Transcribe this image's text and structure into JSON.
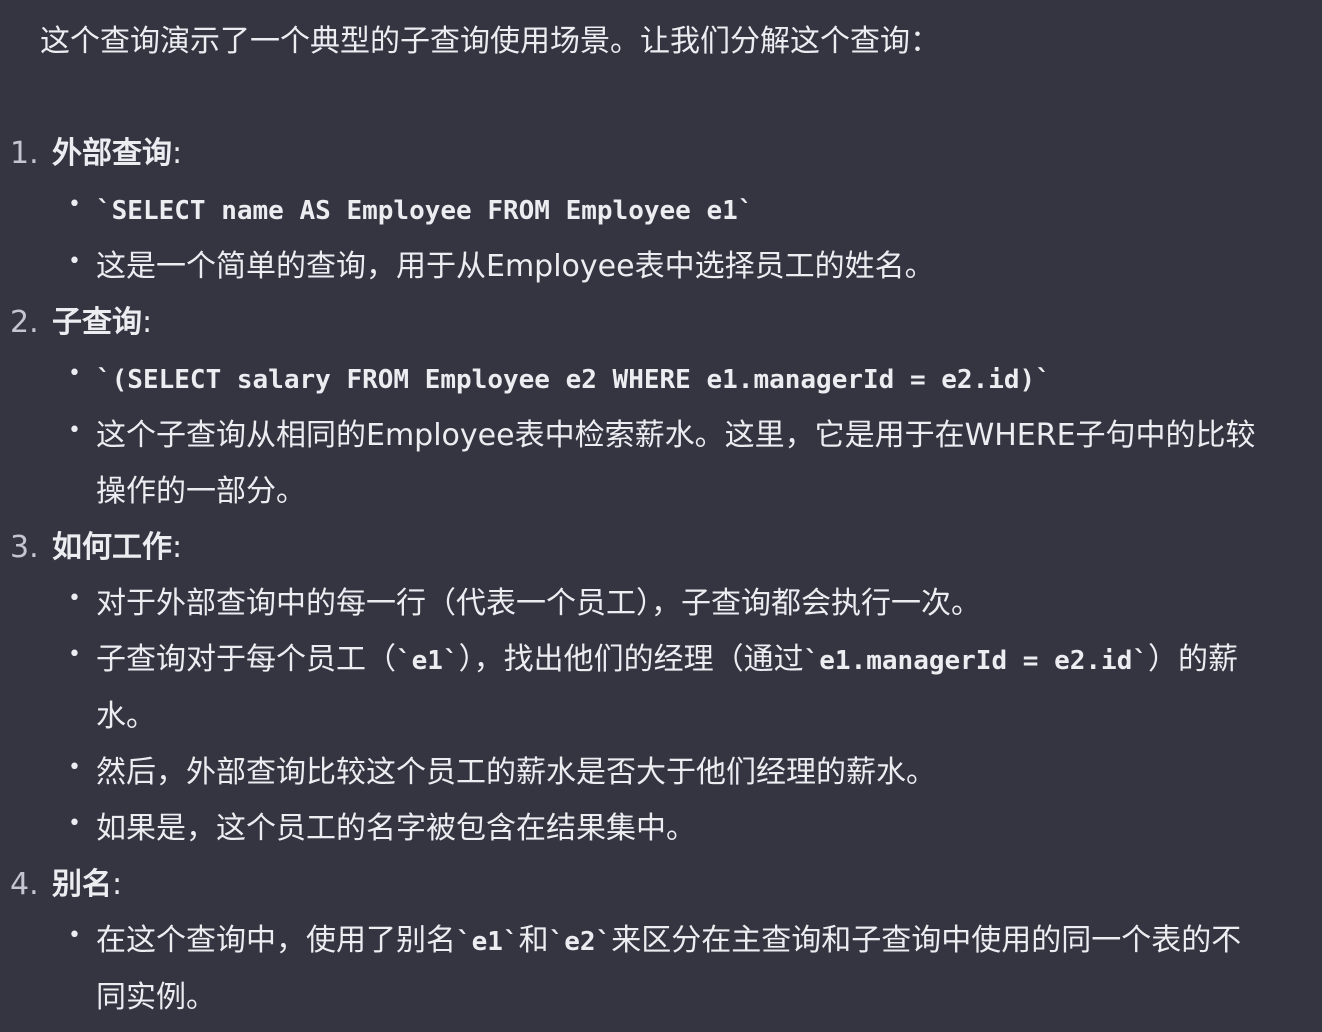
{
  "intro": "这个查询演示了一个典型的子查询使用场景。让我们分解这个查询：",
  "sections": [
    {
      "num": "1.",
      "title": "外部查询",
      "colon": ":",
      "items": [
        {
          "code": "`SELECT name AS Employee FROM Employee e1`"
        },
        {
          "text": "这是一个简单的查询，用于从Employee表中选择员工的姓名。"
        }
      ]
    },
    {
      "num": "2.",
      "title": "子查询",
      "colon": ":",
      "items": [
        {
          "code": "`(SELECT salary FROM Employee e2 WHERE e1.managerId = e2.id)`"
        },
        {
          "text": "这个子查询从相同的Employee表中检索薪水。这里，它是用于在WHERE子句中的比较操作的一部分。"
        }
      ]
    },
    {
      "num": "3.",
      "title": "如何工作",
      "colon": ":",
      "items": [
        {
          "text": "对于外部查询中的每一行（代表一个员工），子查询都会执行一次。"
        },
        {
          "part1": "子查询对于每个员工（",
          "code1": "`e1`",
          "part2": "），找出他们的经理（通过",
          "code2": "`e1.managerId = e2.id`",
          "part3": "）的薪水。"
        },
        {
          "text": "然后，外部查询比较这个员工的薪水是否大于他们经理的薪水。"
        },
        {
          "text": "如果是，这个员工的名字被包含在结果集中。"
        }
      ]
    },
    {
      "num": "4.",
      "title": "别名",
      "colon": ":",
      "items": [
        {
          "part1": "在这个查询中，使用了别名",
          "code1": "`e1`",
          "part2": "和",
          "code2": "`e2`",
          "part3": "来区分在主查询和子查询中使用的同一个表的不同实例。"
        }
      ]
    }
  ],
  "bullet_char": "•"
}
